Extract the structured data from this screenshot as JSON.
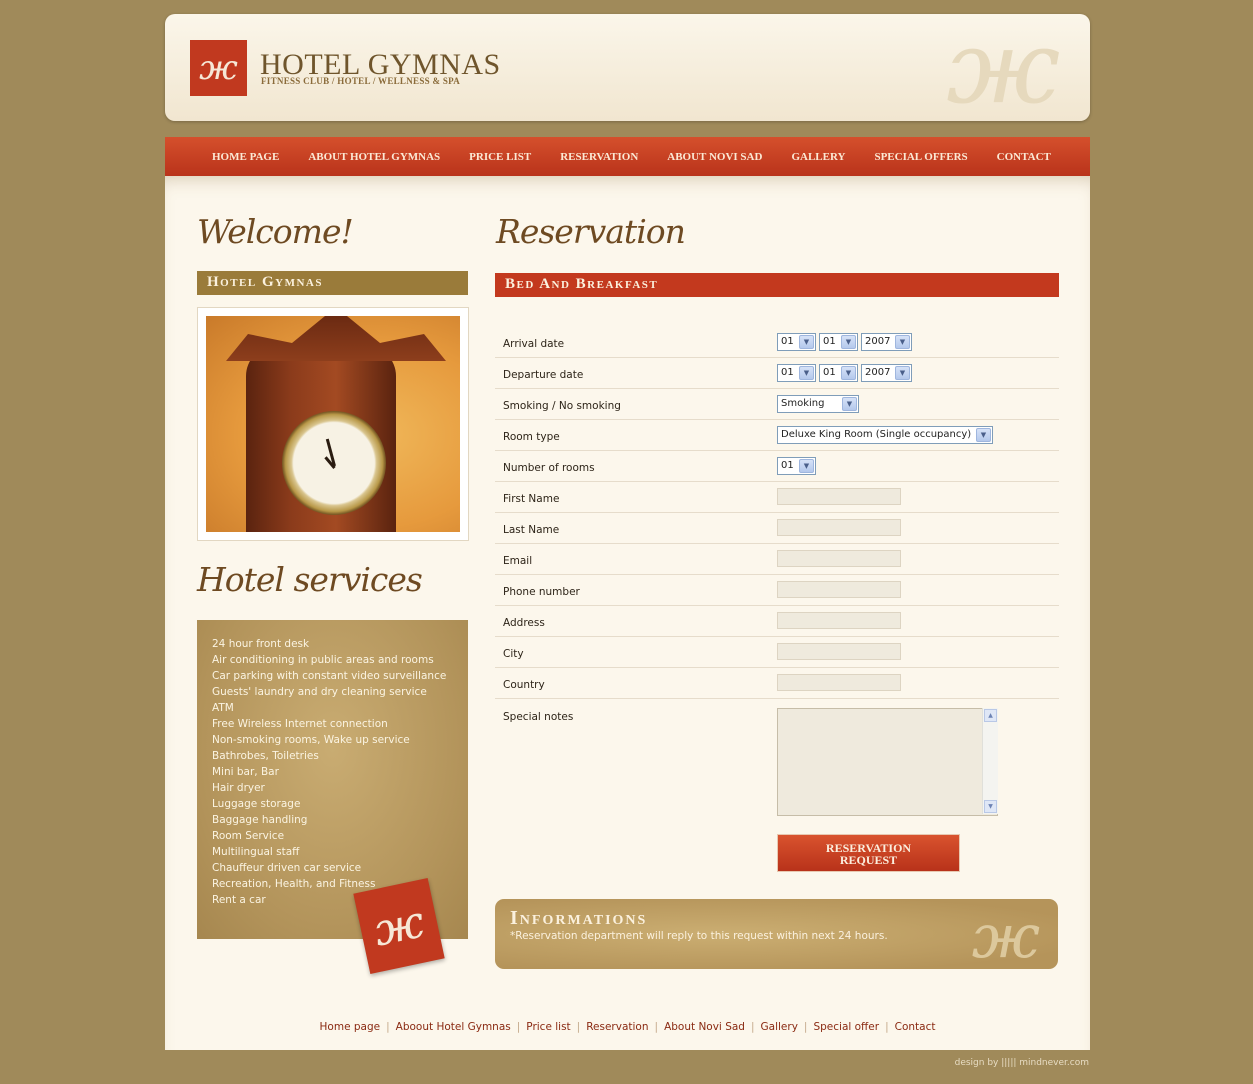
{
  "header": {
    "logo_title": "HOTEL GYMNAS",
    "logo_subtitle": "FITNESS CLUB / HOTEL / WELLNESS & SPA"
  },
  "nav": {
    "items": [
      {
        "label": "HOME PAGE"
      },
      {
        "label": "ABOUT HOTEL GYMNAS"
      },
      {
        "label": "PRICE LIST"
      },
      {
        "label": "RESERVATION"
      },
      {
        "label": "ABOUT NOVI SAD"
      },
      {
        "label": "GALLERY"
      },
      {
        "label": "SPECIAL OFFERS"
      },
      {
        "label": "CONTACT"
      }
    ]
  },
  "sidebar": {
    "welcome_heading": "Welcome!",
    "hotel_bar": "Hotel Gymnas",
    "services_heading": "Hotel services",
    "services": [
      "24 hour front desk",
      "Air conditioning in public areas and rooms",
      "Car parking with constant video surveillance",
      "Guests' laundry and dry cleaning service",
      "ATM",
      "Free Wireless Internet connection",
      "Non-smoking rooms, Wake up service",
      "Bathrobes, Toiletries",
      "Mini bar, Bar",
      "Hair dryer",
      "Luggage storage",
      "Baggage handling",
      "Room Service",
      "Multilingual staff",
      "Chauffeur driven car service",
      "Recreation, Health, and Fitness",
      "Rent a car"
    ]
  },
  "form": {
    "heading": "Reservation",
    "bar": "Bed And Breakfast",
    "arrival": {
      "label": "Arrival date",
      "day": "01",
      "month": "01",
      "year": "2007"
    },
    "departure": {
      "label": "Departure date",
      "day": "01",
      "month": "01",
      "year": "2007"
    },
    "smoking": {
      "label": "Smoking / No smoking",
      "value": "Smoking"
    },
    "room_type": {
      "label": "Room type",
      "value": "Deluxe King Room (Single occupancy)"
    },
    "rooms": {
      "label": "Number of rooms",
      "value": "01"
    },
    "first_name": {
      "label": "First Name",
      "value": ""
    },
    "last_name": {
      "label": "Last Name",
      "value": ""
    },
    "email": {
      "label": "Email",
      "value": ""
    },
    "phone": {
      "label": "Phone number",
      "value": ""
    },
    "address": {
      "label": "Address",
      "value": ""
    },
    "city": {
      "label": "City",
      "value": ""
    },
    "country": {
      "label": "Country",
      "value": ""
    },
    "notes": {
      "label": "Special notes",
      "value": ""
    },
    "submit_line1": "RESERVATION",
    "submit_line2": "REQUEST"
  },
  "info": {
    "title": "Informations",
    "text": "*Reservation department will reply to this request within next 24 hours."
  },
  "footer": {
    "links": [
      "Home page",
      "Aboout Hotel Gymnas",
      "Price list",
      "Reservation",
      "About Novi Sad",
      "Gallery",
      "Special offer",
      "Contact"
    ],
    "credit": "design by ||||| mindnever.com"
  },
  "colors": {
    "background": "#a08a5a",
    "accent_red": "#c3391e",
    "gold_bar": "#9a7b3a",
    "content_bg": "#fcf7ec"
  }
}
